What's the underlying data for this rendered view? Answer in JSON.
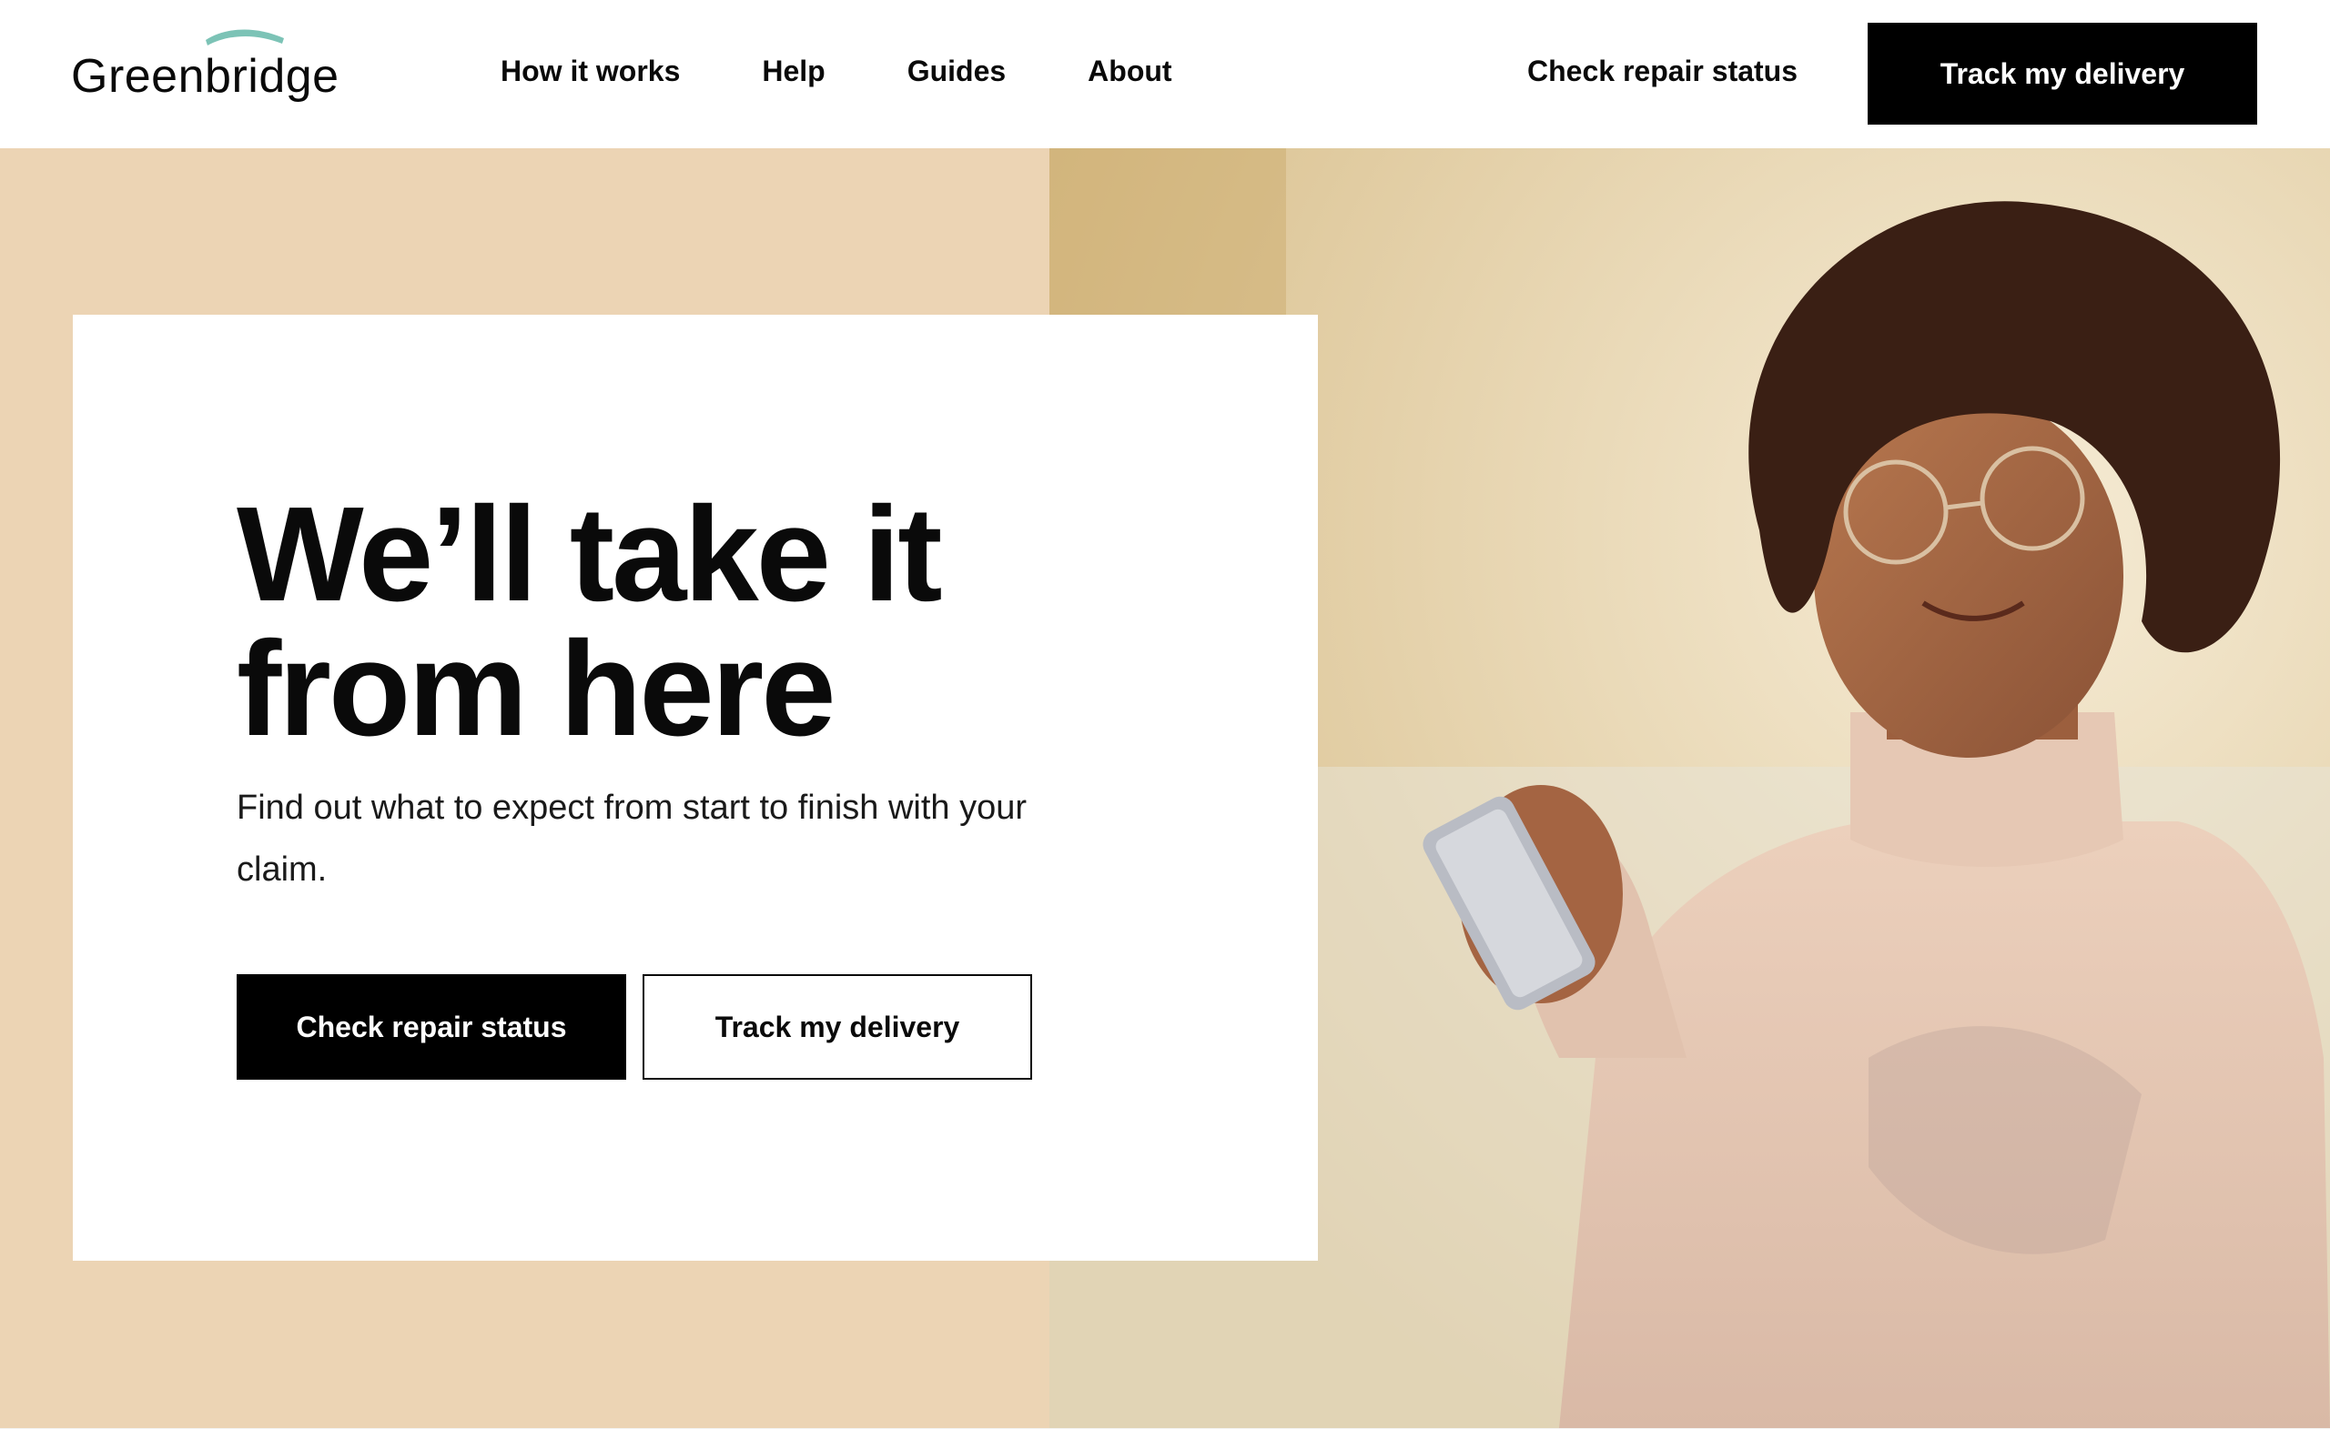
{
  "brand": {
    "name": "Greenbridge",
    "accent_color": "#7cc3b6"
  },
  "header": {
    "nav": [
      {
        "label": "How it works"
      },
      {
        "label": "Help"
      },
      {
        "label": "Guides"
      },
      {
        "label": "About"
      }
    ],
    "repair_link": "Check repair status",
    "delivery_button": "Track my delivery"
  },
  "hero": {
    "headline": "We’ll take it from here",
    "subtext": "Find out what to expect from start to finish with your claim.",
    "primary_button": "Check repair status",
    "secondary_button": "Track my delivery",
    "background_color": "#ecd4b4",
    "image_subject": "woman-with-phone-photo"
  }
}
